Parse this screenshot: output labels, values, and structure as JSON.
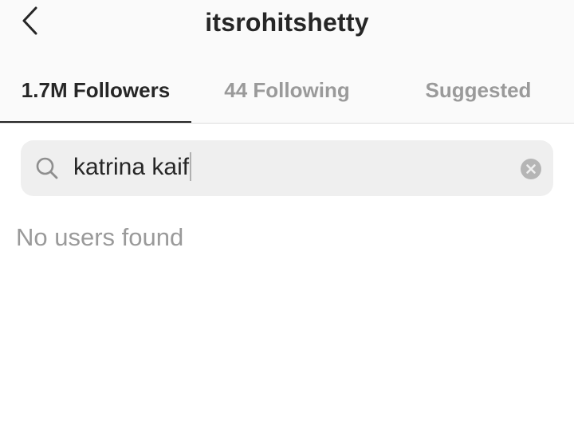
{
  "header": {
    "title": "itsrohitshetty",
    "back_icon": "chevron-left-icon"
  },
  "tabs": [
    {
      "label": "1.7M Followers",
      "active": true
    },
    {
      "label": "44 Following",
      "active": false
    },
    {
      "label": "Suggested",
      "active": false
    }
  ],
  "search": {
    "icon": "search-icon",
    "value": "katrina kaif",
    "clear_icon": "clear-circle-icon"
  },
  "results": {
    "empty_message": "No users found"
  },
  "colors": {
    "text_primary": "#262626",
    "text_secondary": "#9a9a9a",
    "search_bg": "#efefef",
    "header_bg": "#fafafa"
  }
}
